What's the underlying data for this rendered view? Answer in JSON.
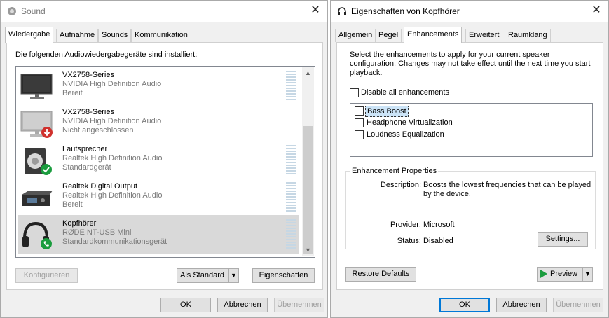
{
  "sound": {
    "title": "Sound",
    "tabs": [
      "Wiedergabe",
      "Aufnahme",
      "Sounds",
      "Kommunikation"
    ],
    "instruction": "Die folgenden Audiowiedergabegeräte sind installiert:",
    "devices": [
      {
        "name": "VX2758-Series",
        "driver": "NVIDIA High Definition Audio",
        "status": "Bereit",
        "icon": "monitor-icon"
      },
      {
        "name": "VX2758-Series",
        "driver": "NVIDIA High Definition Audio",
        "status": "Nicht angeschlossen",
        "icon": "monitor-disconnected-icon"
      },
      {
        "name": "Lautsprecher",
        "driver": "Realtek High Definition Audio",
        "status": "Standardgerät",
        "icon": "speaker-icon"
      },
      {
        "name": "Realtek Digital Output",
        "driver": "Realtek High Definition Audio",
        "status": "Bereit",
        "icon": "digital-output-icon"
      },
      {
        "name": "Kopfhörer",
        "driver": "RØDE NT-USB Mini",
        "status": "Standardkommunikationsgerät",
        "icon": "headphones-icon"
      }
    ],
    "buttons": {
      "configure": "Konfigurieren",
      "set_default": "Als Standard",
      "properties": "Eigenschaften",
      "ok": "OK",
      "cancel": "Abbrechen",
      "apply": "Übernehmen"
    }
  },
  "props": {
    "title": "Eigenschaften von Kopfhörer",
    "tabs": [
      "Allgemein",
      "Pegel",
      "Enhancements",
      "Erweitert",
      "Raumklang"
    ],
    "intro": "Select the enhancements to apply for your current speaker configuration. Changes may not take effect until the next time you start playback.",
    "disable_all": "Disable all enhancements",
    "enhancements": [
      "Bass Boost",
      "Headphone Virtualization",
      "Loudness Equalization"
    ],
    "properties_group": "Enhancement Properties",
    "description_label": "Description:",
    "description_value": "Boosts the lowest frequencies that can be played by the device.",
    "provider_label": "Provider:",
    "provider_value": "Microsoft",
    "status_label": "Status:",
    "status_value": "Disabled",
    "buttons": {
      "settings": "Settings...",
      "restore": "Restore Defaults",
      "preview": "Preview",
      "ok": "OK",
      "cancel": "Abbrechen",
      "apply": "Übernehmen"
    }
  },
  "colors": {
    "accent": "#0078d7",
    "check_green": "#1a9c3e",
    "disconnect_red": "#d0312d"
  }
}
